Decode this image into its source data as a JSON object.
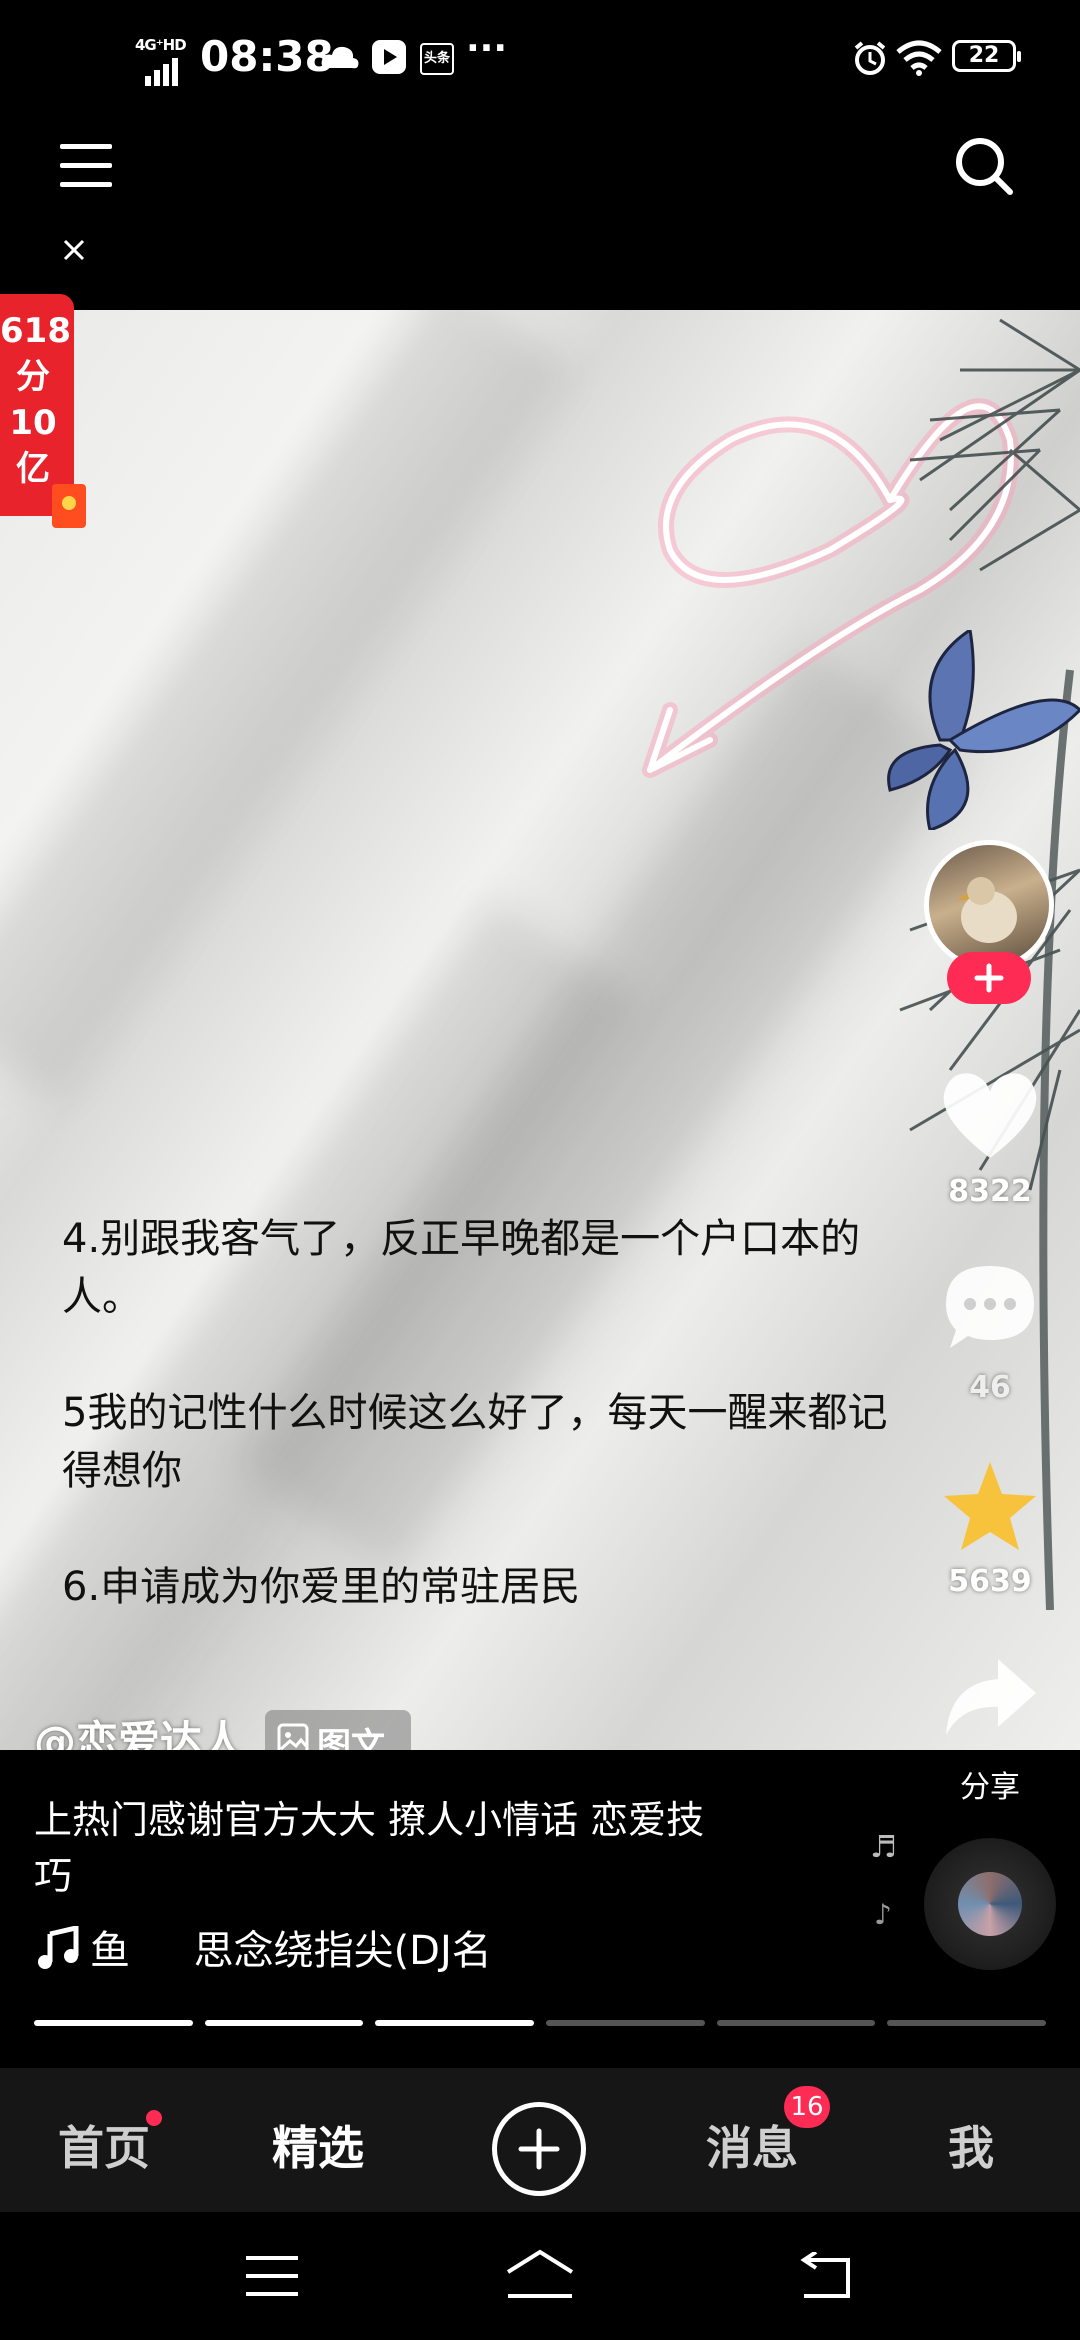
{
  "status": {
    "network": "4G⁺HD",
    "time": "08:38",
    "app_badge": "头条",
    "more": "···",
    "battery": "22"
  },
  "promo": {
    "line1": "618",
    "line2": "分",
    "line3": "10",
    "line4": "亿"
  },
  "post": {
    "lines": [
      "4.别跟我客气了，反正早晚都是一个户口本的",
      "人。",
      "5我的记性什么时候这么好了，每天一醒来都记",
      "得想你",
      "6.申请成为你爱里的常驻居民"
    ]
  },
  "rail": {
    "likes": "8322",
    "comments": "46",
    "favorites": "5639",
    "share_label": "分享"
  },
  "info": {
    "author": "@恋爱达人",
    "type_tag": "图文",
    "caption_line1": "上热门感谢官方大大  撩人小情话  恋爱技",
    "caption_line2": "巧",
    "music": "鱼     思念绕指尖(DJ名"
  },
  "nav": {
    "home": "首页",
    "featured": "精选",
    "messages": "消息",
    "messages_badge": "16",
    "me": "我"
  },
  "progress": {
    "total": 6,
    "filled": 3
  }
}
